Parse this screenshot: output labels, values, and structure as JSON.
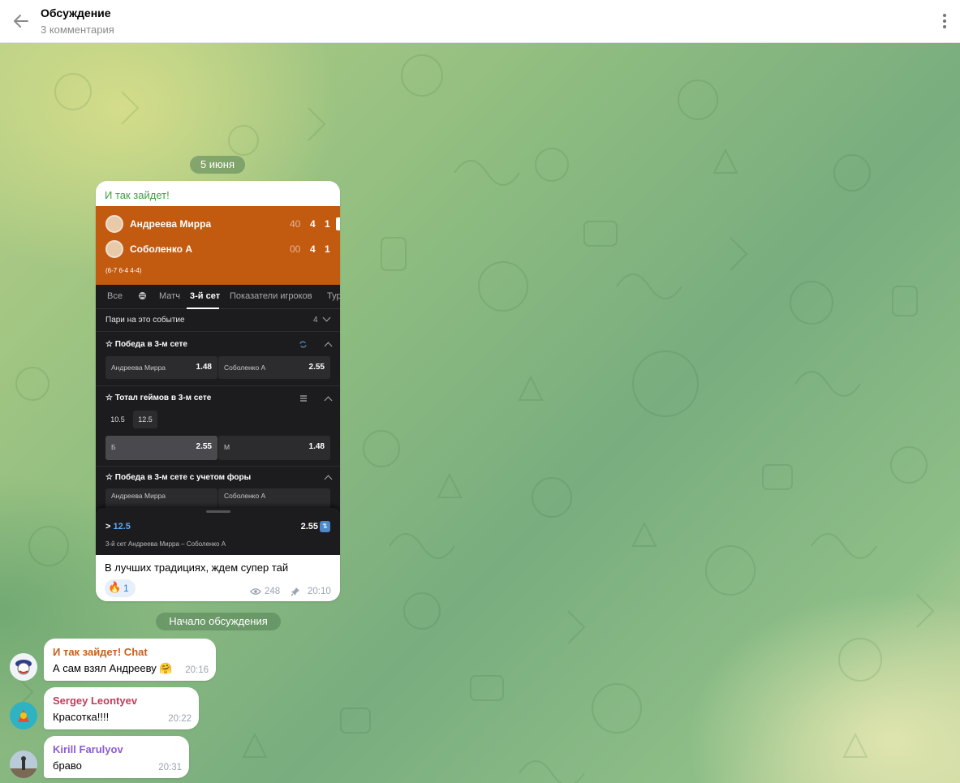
{
  "header": {
    "title": "Обсуждение",
    "subtitle": "3 комментария",
    "back_icon": "arrow-left-icon",
    "menu_icon": "more-vertical-icon"
  },
  "date_pill": "5 июня",
  "discussion_pill": "Начало обсуждения",
  "post": {
    "author": "И так зайдет!",
    "screenshot": {
      "players": [
        {
          "name": "Андреева Мирра",
          "points": "40",
          "games": "4",
          "sets": "1"
        },
        {
          "name": "Соболенко А",
          "points": "00",
          "games": "4",
          "sets": "1"
        }
      ],
      "set_scores": "(6-7 6-4 4-4)",
      "tabs": [
        "Все",
        "Матч",
        "3-й сет",
        "Показатели игроков",
        "Тур"
      ],
      "bets_header": "Пари на это событие",
      "bets_count": "4",
      "markets": [
        {
          "title": "Победа в 3-м сете",
          "odds": [
            {
              "label": "Андреева Мирра",
              "value": "1.48"
            },
            {
              "label": "Соболенко А",
              "value": "2.55"
            }
          ]
        },
        {
          "title": "Тотал геймов в 3-м сете",
          "lines": [
            "10.5",
            "12.5"
          ],
          "odds": [
            {
              "label": "Б",
              "value": "2.55"
            },
            {
              "label": "М",
              "value": "1.48"
            }
          ]
        },
        {
          "title": "Победа в 3-м сете с учетом форы",
          "odds": [
            {
              "label": "Андреева Мирра",
              "value": ""
            },
            {
              "label": "Соболенко А",
              "value": ""
            }
          ]
        }
      ],
      "betslip": {
        "prefix": ">",
        "line": "12.5",
        "odd": "2.55",
        "subtitle": "3-й сет Андреева Мирра – Соболенко А"
      }
    },
    "text": "В лучших традициях, ждем супер тай",
    "reaction": {
      "emoji": "🔥",
      "count": "1"
    },
    "views": "248",
    "time": "20:10"
  },
  "comments": [
    {
      "author": "И так зайдет! Chat",
      "author_color": "#c8601e",
      "text": "А сам взял Андрееву",
      "emoji": "🤗",
      "time": "20:16"
    },
    {
      "author": "Sergey Leontyev",
      "author_color": "#c03d5a",
      "text": "Красотка!!!!",
      "emoji": "",
      "time": "20:22"
    },
    {
      "author": "Kirill Farulyov",
      "author_color": "#8a5bd6",
      "text": "браво",
      "emoji": "",
      "time": "20:31"
    }
  ],
  "colors": {
    "accent_green": "#3f9f3f",
    "score_orange": "#c25a10",
    "link_blue": "#2f7fd1"
  }
}
